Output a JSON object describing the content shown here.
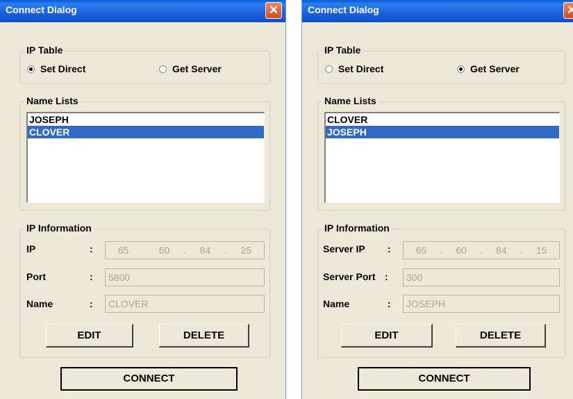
{
  "left": {
    "title": "Connect Dialog",
    "close_glyph": "✕",
    "ip_table": {
      "legend": "IP Table",
      "options": [
        "Set Direct",
        "Get Server"
      ],
      "selected": 0
    },
    "name_lists": {
      "legend": "Name Lists",
      "items": [
        "JOSEPH",
        "CLOVER"
      ],
      "selected_index": 1
    },
    "ip_info": {
      "legend": "IP Information",
      "ip_label": "IP",
      "port_label": "Port",
      "name_label": "Name",
      "colon": ":",
      "ip_octets": [
        "65",
        "60",
        "84",
        "25"
      ],
      "ip_dot": ".",
      "port_value": "5800",
      "name_value": "CLOVER"
    },
    "edit_label": "EDIT",
    "delete_label": "DELETE",
    "connect_label": "CONNECT"
  },
  "right": {
    "title": "Connect Dialog",
    "close_glyph": "✕",
    "ip_table": {
      "legend": "IP Table",
      "options": [
        "Set Direct",
        "Get Server"
      ],
      "selected": 1
    },
    "name_lists": {
      "legend": "Name Lists",
      "items": [
        "CLOVER",
        "JOSEPH"
      ],
      "selected_index": 1
    },
    "ip_info": {
      "legend": "IP Information",
      "ip_label": "Server IP",
      "port_label": "Server Port",
      "name_label": "Name",
      "colon": ":",
      "ip_octets": [
        "65",
        "60",
        "84",
        "15"
      ],
      "ip_dot": ".",
      "port_value": "300",
      "name_value": "JOSEPH"
    },
    "edit_label": "EDIT",
    "delete_label": "DELETE",
    "connect_label": "CONNECT"
  },
  "colors": {
    "titlebar": "#0a5ad8",
    "dialog_bg": "#ece9d8",
    "selection": "#316ac5",
    "close_button": "#d14b26"
  },
  "icons": [
    "close-icon",
    "radio-button-icon"
  ]
}
